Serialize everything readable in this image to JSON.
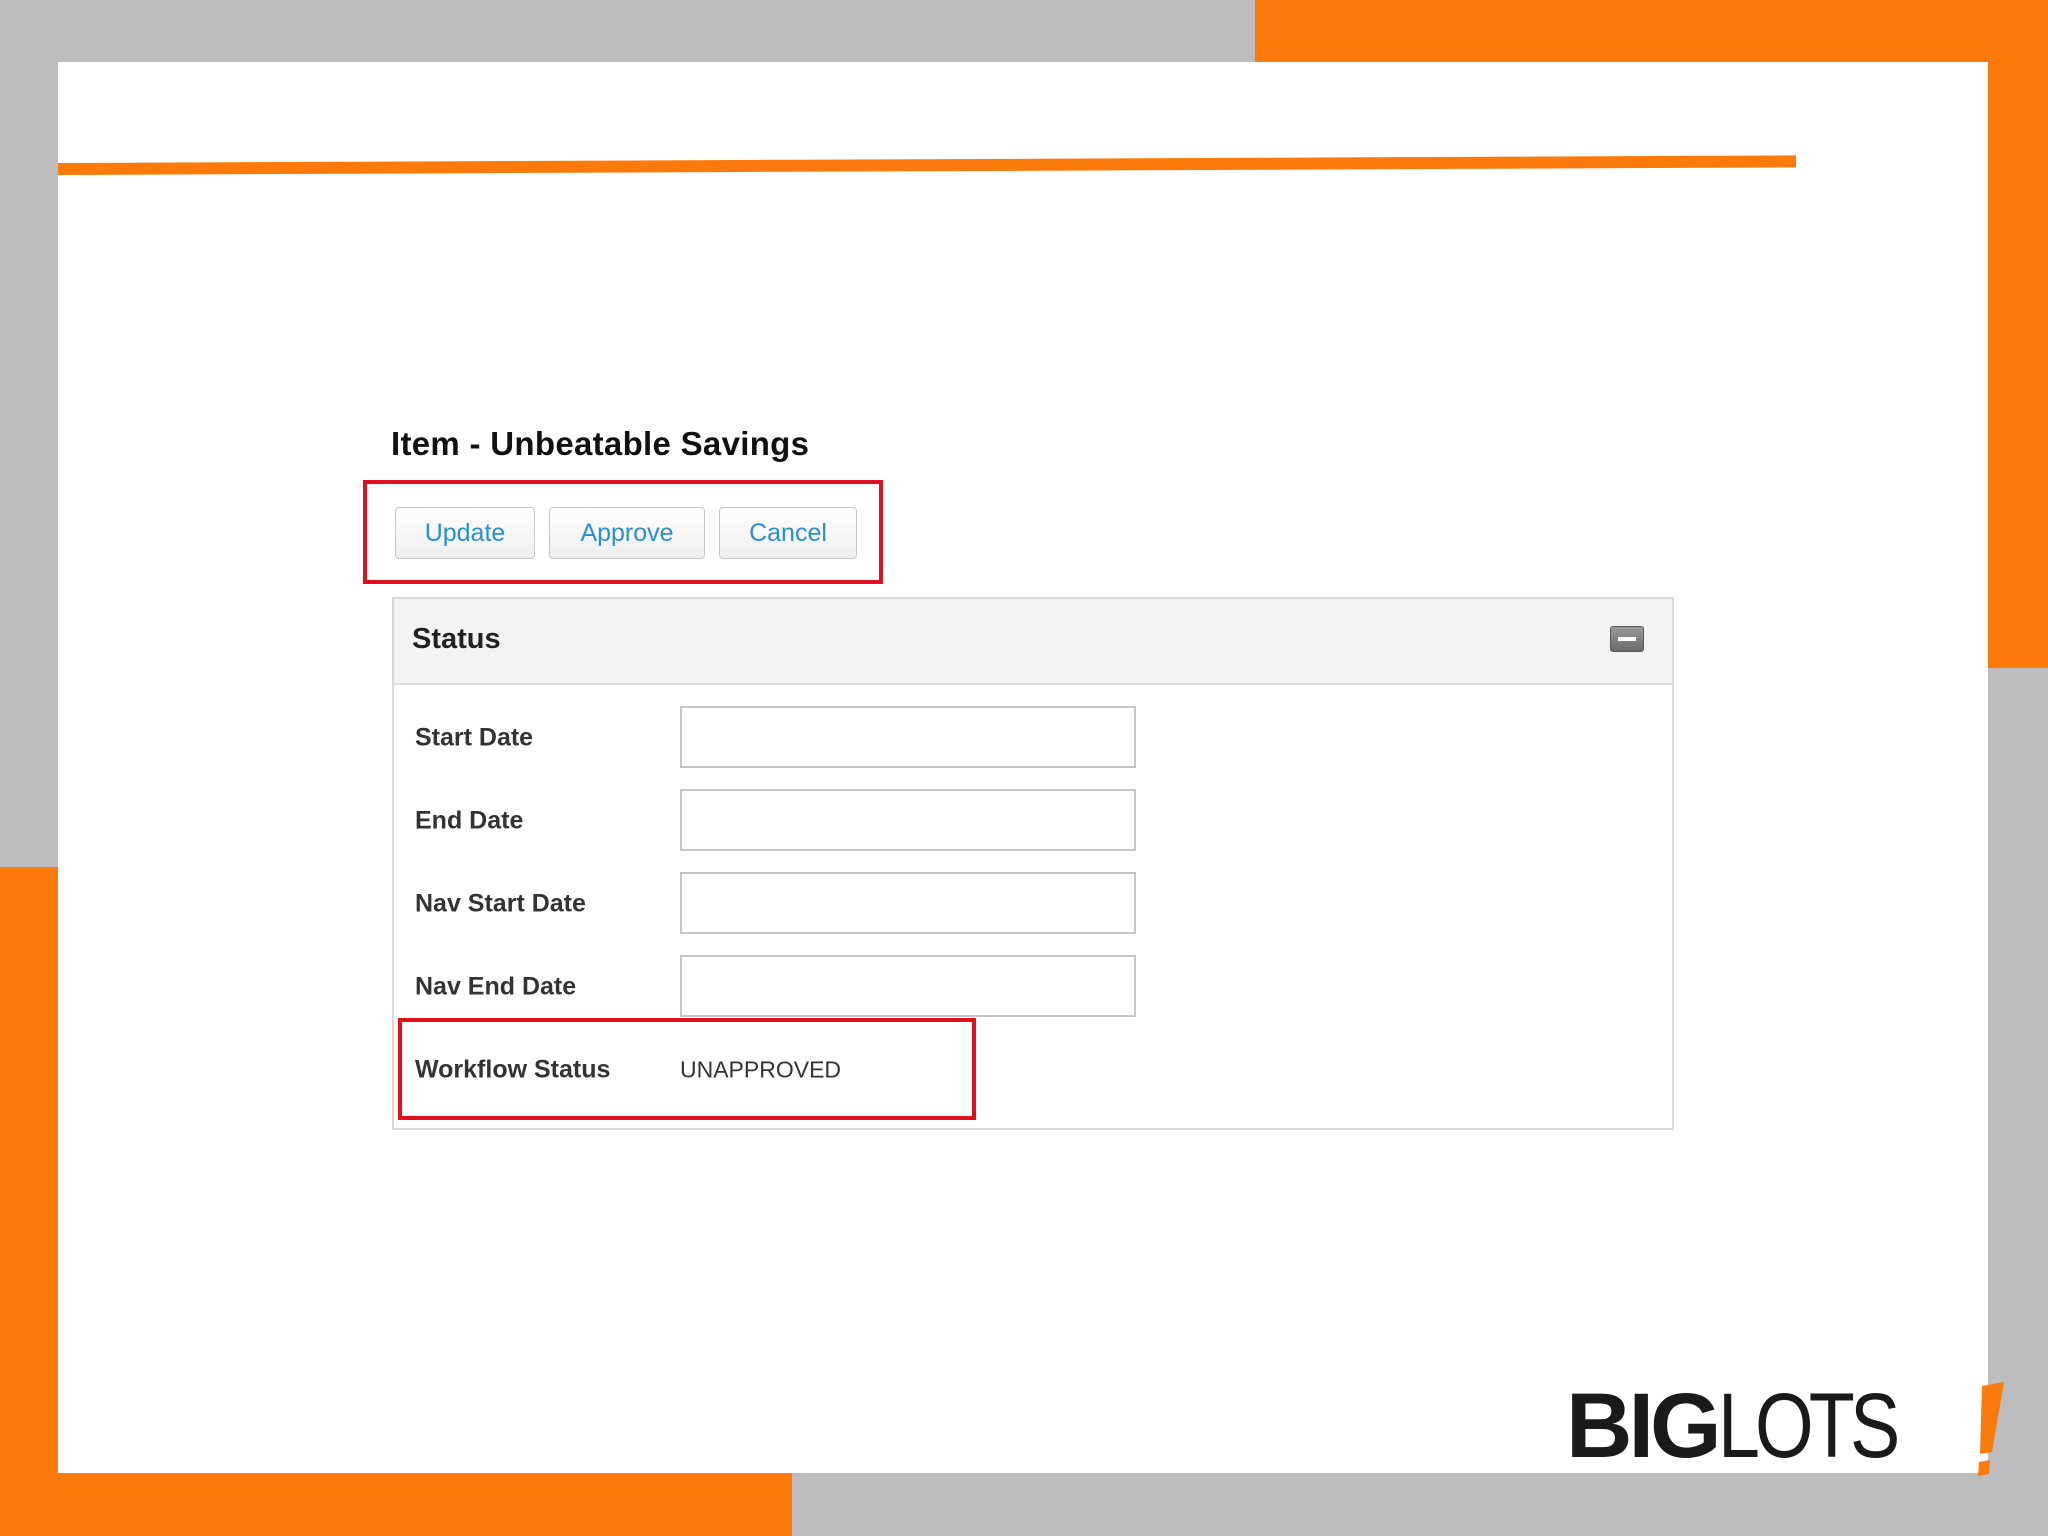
{
  "form": {
    "title": "Item - Unbeatable Savings"
  },
  "toolbar": {
    "update_label": "Update",
    "approve_label": "Approve",
    "cancel_label": "Cancel"
  },
  "panel": {
    "title": "Status",
    "collapse_icon": "minus-icon",
    "fields": [
      {
        "label": "Start Date",
        "value": ""
      },
      {
        "label": "End Date",
        "value": ""
      },
      {
        "label": "Nav Start Date",
        "value": ""
      },
      {
        "label": "Nav End Date",
        "value": ""
      }
    ],
    "workflow": {
      "label": "Workflow Status",
      "value": "UNAPPROVED"
    }
  },
  "logo": {
    "big": "BIG",
    "lots": "LOTS"
  },
  "colors": {
    "brand_orange": "#fc7a0b",
    "highlight_red": "#e0101e",
    "button_text_blue": "#2a8fd0"
  }
}
